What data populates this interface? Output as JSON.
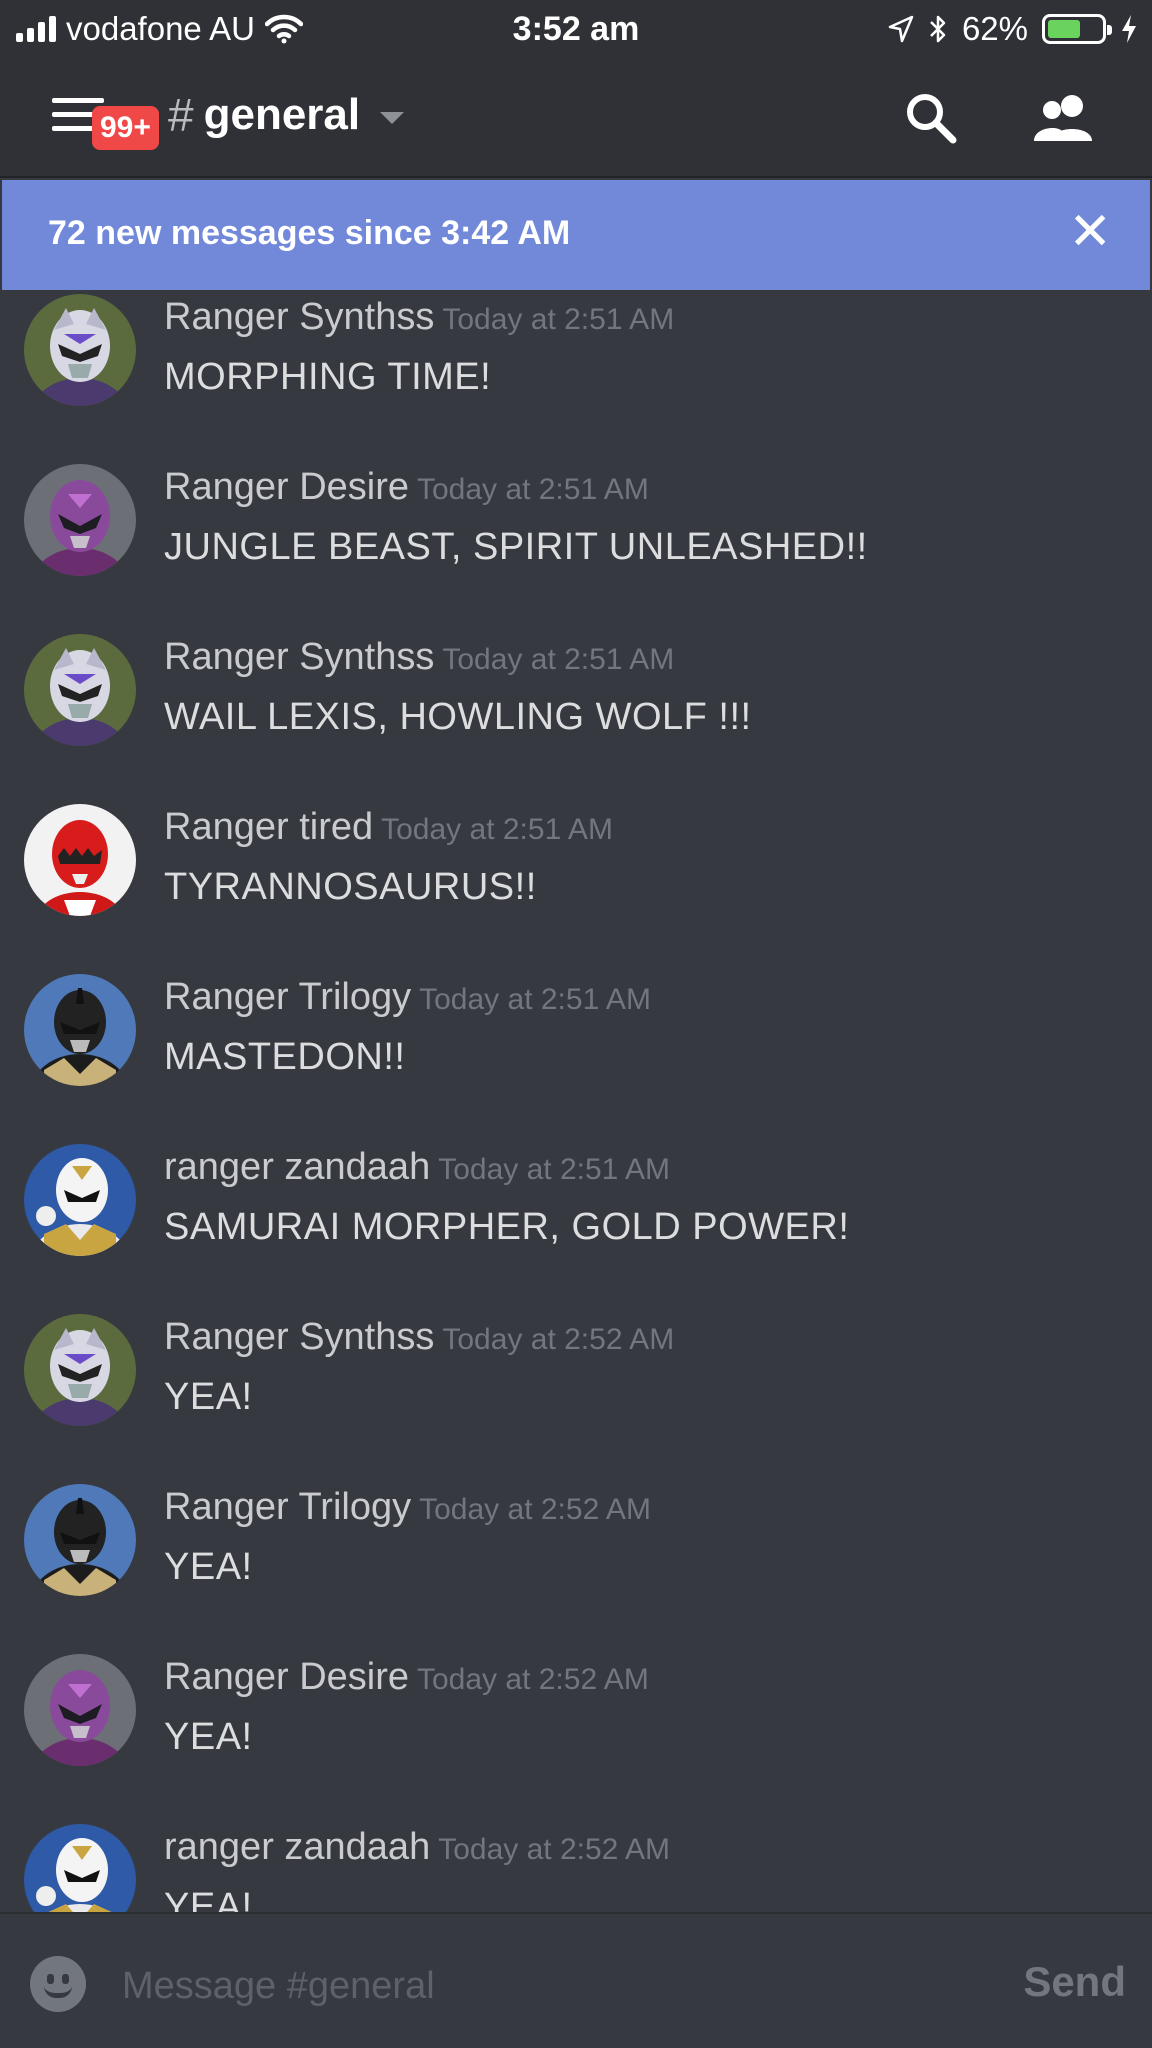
{
  "status_bar": {
    "carrier": "vodafone AU",
    "time": "3:52 am",
    "battery_percent": "62%",
    "battery_level": 0.62
  },
  "header": {
    "notification_badge": "99+",
    "channel_hash": "#",
    "channel_name": "general"
  },
  "banner": {
    "text": "72 new messages since 3:42 AM",
    "close_icon": "close-icon"
  },
  "messages": [
    {
      "author": "Ranger Synthss",
      "timestamp": "Today at 2:51 AM",
      "text": "MORPHING TIME!",
      "avatar": "purple-silver-ranger"
    },
    {
      "author": "Ranger Desire",
      "timestamp": "Today at 2:51 AM",
      "text": "JUNGLE BEAST, SPIRIT UNLEASHED!!",
      "avatar": "violet-ranger"
    },
    {
      "author": "Ranger Synthss",
      "timestamp": "Today at 2:51 AM",
      "text": "WAIL LEXIS, HOWLING WOLF !!!",
      "avatar": "purple-silver-ranger"
    },
    {
      "author": "Ranger tired",
      "timestamp": "Today at 2:51 AM",
      "text": "TYRANNOSAURUS!!",
      "avatar": "red-ranger"
    },
    {
      "author": "Ranger Trilogy",
      "timestamp": "Today at 2:51 AM",
      "text": "MASTEDON!!",
      "avatar": "black-ranger"
    },
    {
      "author": "ranger zandaah",
      "timestamp": "Today at 2:51 AM",
      "text": "SAMURAI MORPHER, GOLD POWER!",
      "avatar": "white-gold-ranger"
    },
    {
      "author": "Ranger Synthss",
      "timestamp": "Today at 2:52 AM",
      "text": "YEA!",
      "avatar": "purple-silver-ranger"
    },
    {
      "author": "Ranger Trilogy",
      "timestamp": "Today at 2:52 AM",
      "text": "YEA!",
      "avatar": "black-ranger"
    },
    {
      "author": "Ranger Desire",
      "timestamp": "Today at 2:52 AM",
      "text": "YEA!",
      "avatar": "violet-ranger"
    },
    {
      "author": "ranger zandaah",
      "timestamp": "Today at 2:52 AM",
      "text": "YEA!",
      "avatar": "white-gold-ranger"
    }
  ],
  "composer": {
    "placeholder": "Message #general",
    "send_label": "Send"
  },
  "colors": {
    "background": "#36393f",
    "header": "#2f3136",
    "banner": "#7289da",
    "badge": "#f04747"
  }
}
